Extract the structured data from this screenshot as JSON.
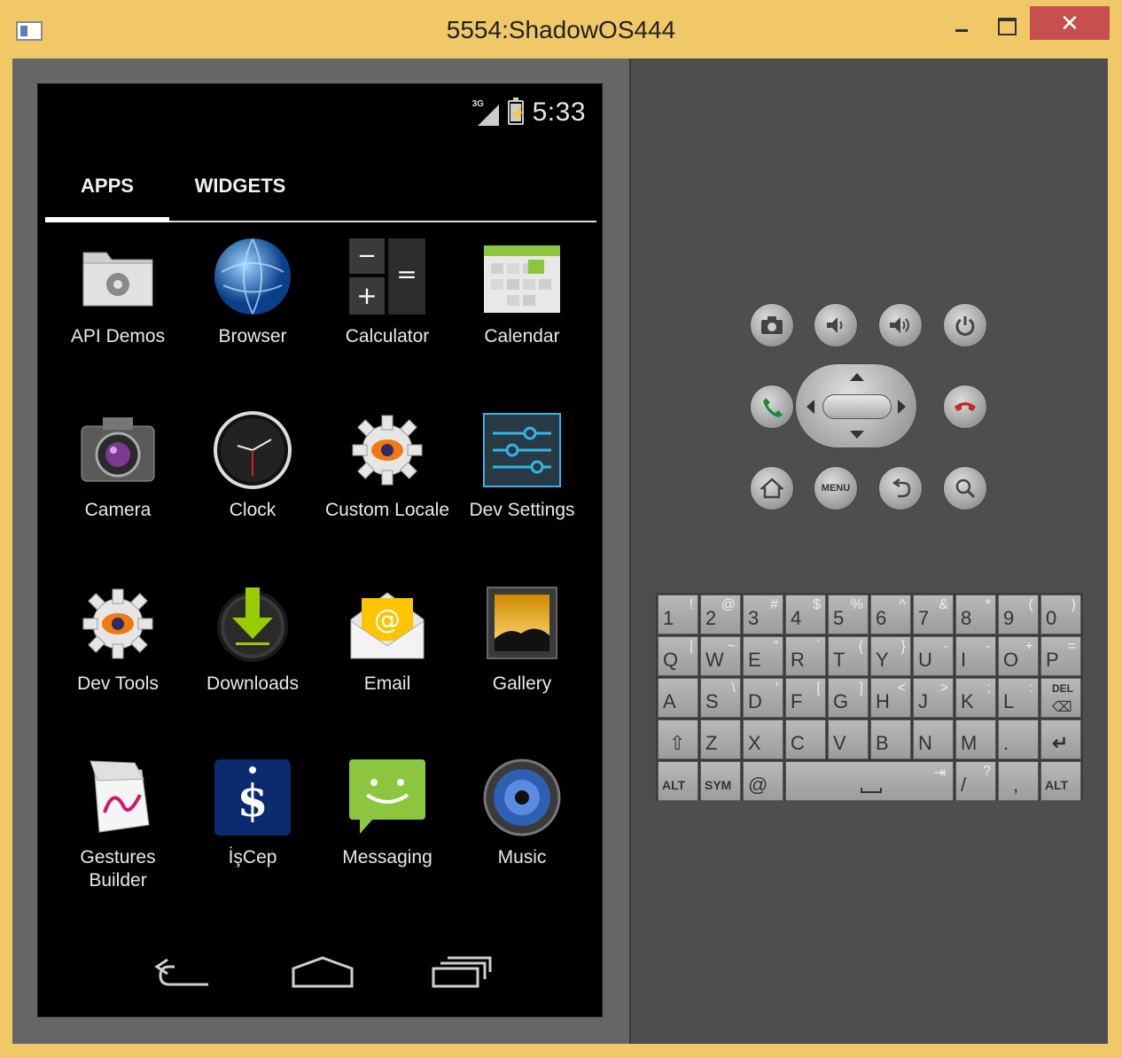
{
  "window": {
    "title": "5554:ShadowOS444",
    "close_label": "✕"
  },
  "status_bar": {
    "network": "3G",
    "time": "5:33"
  },
  "tabs": [
    {
      "label": "APPS"
    },
    {
      "label": "WIDGETS"
    }
  ],
  "apps": [
    {
      "label": "API Demos",
      "icon": "folder-gear-icon"
    },
    {
      "label": "Browser",
      "icon": "globe-icon"
    },
    {
      "label": "Calculator",
      "icon": "calculator-icon"
    },
    {
      "label": "Calendar",
      "icon": "calendar-icon"
    },
    {
      "label": "Camera",
      "icon": "camera-icon"
    },
    {
      "label": "Clock",
      "icon": "clock-icon"
    },
    {
      "label": "Custom Locale",
      "icon": "gear-icon"
    },
    {
      "label": "Dev Settings",
      "icon": "sliders-icon"
    },
    {
      "label": "Dev Tools",
      "icon": "gear-icon"
    },
    {
      "label": "Downloads",
      "icon": "download-icon"
    },
    {
      "label": "Email",
      "icon": "email-icon"
    },
    {
      "label": "Gallery",
      "icon": "gallery-icon"
    },
    {
      "label": "Gestures Builder",
      "icon": "gestures-icon"
    },
    {
      "label": "İşCep",
      "icon": "iscep-icon"
    },
    {
      "label": "Messaging",
      "icon": "message-icon"
    },
    {
      "label": "Music",
      "icon": "speaker-icon"
    }
  ],
  "hardware_buttons": {
    "menu_label": "MENU"
  },
  "keyboard": {
    "rows": [
      [
        {
          "k": "1",
          "a": "!"
        },
        {
          "k": "2",
          "a": "@"
        },
        {
          "k": "3",
          "a": "#"
        },
        {
          "k": "4",
          "a": "$"
        },
        {
          "k": "5",
          "a": "%"
        },
        {
          "k": "6",
          "a": "^"
        },
        {
          "k": "7",
          "a": "&"
        },
        {
          "k": "8",
          "a": "*"
        },
        {
          "k": "9",
          "a": "("
        },
        {
          "k": "0",
          "a": ")"
        }
      ],
      [
        {
          "k": "Q",
          "a": "|"
        },
        {
          "k": "W",
          "a": "~"
        },
        {
          "k": "E",
          "a": "\""
        },
        {
          "k": "R",
          "a": "`"
        },
        {
          "k": "T",
          "a": "{"
        },
        {
          "k": "Y",
          "a": "}"
        },
        {
          "k": "U",
          "a": "-"
        },
        {
          "k": "I",
          "a": "-"
        },
        {
          "k": "O",
          "a": "+"
        },
        {
          "k": "P",
          "a": "="
        }
      ],
      [
        {
          "k": "A",
          "a": ""
        },
        {
          "k": "S",
          "a": "\\"
        },
        {
          "k": "D",
          "a": "'"
        },
        {
          "k": "F",
          "a": "["
        },
        {
          "k": "G",
          "a": "]"
        },
        {
          "k": "H",
          "a": "<"
        },
        {
          "k": "J",
          "a": ">"
        },
        {
          "k": "K",
          "a": ";"
        },
        {
          "k": "L",
          "a": ":"
        },
        {
          "k": "DEL",
          "a": ""
        }
      ],
      [
        {
          "k": "⇧",
          "a": ""
        },
        {
          "k": "Z",
          "a": ""
        },
        {
          "k": "X",
          "a": ""
        },
        {
          "k": "C",
          "a": ""
        },
        {
          "k": "V",
          "a": ""
        },
        {
          "k": "B",
          "a": ""
        },
        {
          "k": "N",
          "a": ""
        },
        {
          "k": "M",
          "a": ""
        },
        {
          "k": ".",
          "a": ""
        },
        {
          "k": "↵",
          "a": ""
        }
      ]
    ],
    "bottom": {
      "alt": "ALT",
      "sym": "SYM",
      "at": "@",
      "slash": "/",
      "question": "?",
      "comma": ","
    }
  }
}
